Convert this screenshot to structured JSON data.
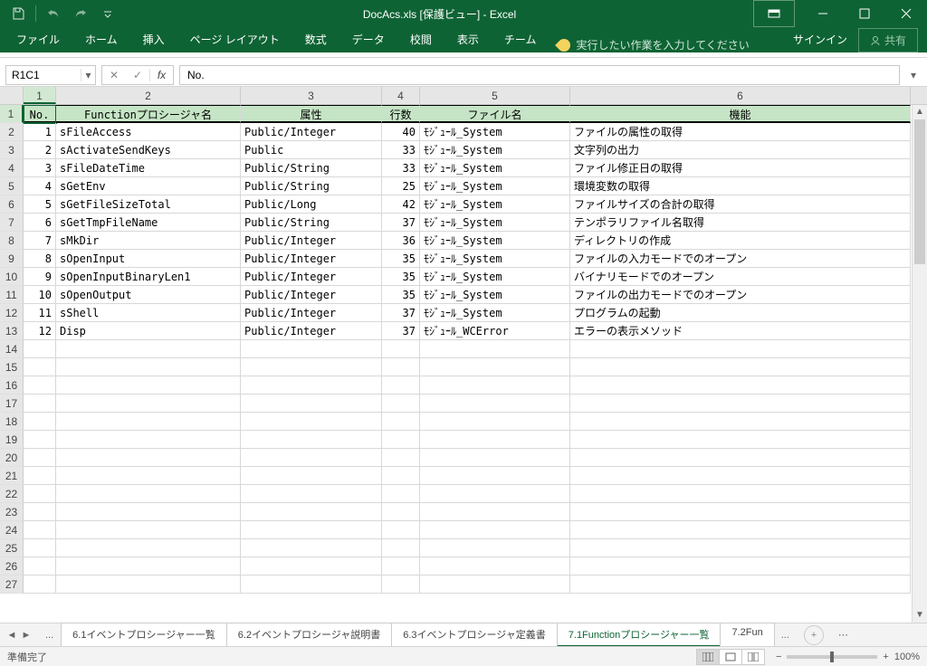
{
  "title": "DocAcs.xls [保護ビュー] - Excel",
  "ribbon": {
    "file": "ファイル",
    "tabs": [
      "ホーム",
      "挿入",
      "ページ レイアウト",
      "数式",
      "データ",
      "校閲",
      "表示",
      "チーム"
    ],
    "tell_me": "実行したい作業を入力してください",
    "signin": "サインイン",
    "share": "共有"
  },
  "namebox": "R1C1",
  "formula": "No.",
  "col_labels": [
    "1",
    "2",
    "3",
    "4",
    "5",
    "6"
  ],
  "headers": {
    "c1": "No.",
    "c2": "Functionプロシージャ名",
    "c3": "属性",
    "c4": "行数",
    "c5": "ファイル名",
    "c6": "機能"
  },
  "data": [
    {
      "no": 1,
      "name": "sFileAccess",
      "attr": "Public/Integer",
      "lines": 40,
      "file": "ﾓｼﾞｭｰﾙ_System",
      "func": "ファイルの属性の取得"
    },
    {
      "no": 2,
      "name": "sActivateSendKeys",
      "attr": "Public",
      "lines": 33,
      "file": "ﾓｼﾞｭｰﾙ_System",
      "func": "文字列の出力"
    },
    {
      "no": 3,
      "name": "sFileDateTime",
      "attr": "Public/String",
      "lines": 33,
      "file": "ﾓｼﾞｭｰﾙ_System",
      "func": "ファイル修正日の取得"
    },
    {
      "no": 4,
      "name": "sGetEnv",
      "attr": "Public/String",
      "lines": 25,
      "file": "ﾓｼﾞｭｰﾙ_System",
      "func": "環境変数の取得"
    },
    {
      "no": 5,
      "name": "sGetFileSizeTotal",
      "attr": "Public/Long",
      "lines": 42,
      "file": "ﾓｼﾞｭｰﾙ_System",
      "func": "ファイルサイズの合計の取得"
    },
    {
      "no": 6,
      "name": "sGetTmpFileName",
      "attr": "Public/String",
      "lines": 37,
      "file": "ﾓｼﾞｭｰﾙ_System",
      "func": "テンポラリファイル名取得"
    },
    {
      "no": 7,
      "name": "sMkDir",
      "attr": "Public/Integer",
      "lines": 36,
      "file": "ﾓｼﾞｭｰﾙ_System",
      "func": "ディレクトリの作成"
    },
    {
      "no": 8,
      "name": "sOpenInput",
      "attr": "Public/Integer",
      "lines": 35,
      "file": "ﾓｼﾞｭｰﾙ_System",
      "func": "ファイルの入力モードでのオープン"
    },
    {
      "no": 9,
      "name": "sOpenInputBinaryLen1",
      "attr": "Public/Integer",
      "lines": 35,
      "file": "ﾓｼﾞｭｰﾙ_System",
      "func": "バイナリモードでのオープン"
    },
    {
      "no": 10,
      "name": "sOpenOutput",
      "attr": "Public/Integer",
      "lines": 35,
      "file": "ﾓｼﾞｭｰﾙ_System",
      "func": "ファイルの出力モードでのオープン"
    },
    {
      "no": 11,
      "name": "sShell",
      "attr": "Public/Integer",
      "lines": 37,
      "file": "ﾓｼﾞｭｰﾙ_System",
      "func": "プログラムの起動"
    },
    {
      "no": 12,
      "name": "Disp",
      "attr": "Public/Integer",
      "lines": 37,
      "file": "ﾓｼﾞｭｰﾙ_WCError",
      "func": "エラーの表示メソッド"
    }
  ],
  "empty_rows_start": 14,
  "empty_rows_end": 27,
  "sheets": {
    "tabs": [
      "6.1イベントプロシージャー一覧",
      "6.2イベントプロシージャ説明書",
      "6.3イベントプロシージャ定義書",
      "7.1Functionプロシージャー一覧",
      "7.2Fun"
    ],
    "active_index": 3,
    "overflow_left": "...",
    "overflow_right": "..."
  },
  "status": {
    "ready": "準備完了",
    "zoom": "100%"
  }
}
